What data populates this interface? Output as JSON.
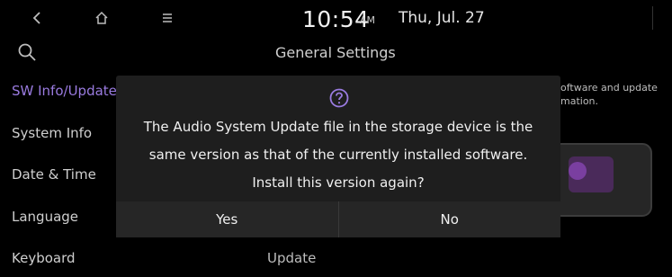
{
  "status_bar": {
    "time": "10:54",
    "ampm": "AM",
    "date": "Thu, Jul. 27"
  },
  "icons": {
    "back": "chevron-left-icon",
    "home": "home-icon",
    "menu": "menu-icon",
    "search": "search-icon",
    "question": "question-icon"
  },
  "page": {
    "title": "General Settings",
    "info_lines": [
      "oftware and update",
      "mation."
    ],
    "update_label": "Update"
  },
  "sidebar": {
    "items": [
      {
        "label": "SW Info/Update",
        "active": true
      },
      {
        "label": "System Info",
        "active": false
      },
      {
        "label": "Date & Time",
        "active": false
      },
      {
        "label": "Language",
        "active": false
      },
      {
        "label": "Keyboard",
        "active": false
      }
    ]
  },
  "dialog": {
    "lines": [
      "The Audio System Update file in the storage device is the",
      "same version as that of the currently installed software.",
      "Install this version again?"
    ],
    "yes_label": "Yes",
    "no_label": "No"
  },
  "colors": {
    "accent": "#9a7be0",
    "dialog_bg": "#1e1e1e",
    "background": "#000000"
  }
}
